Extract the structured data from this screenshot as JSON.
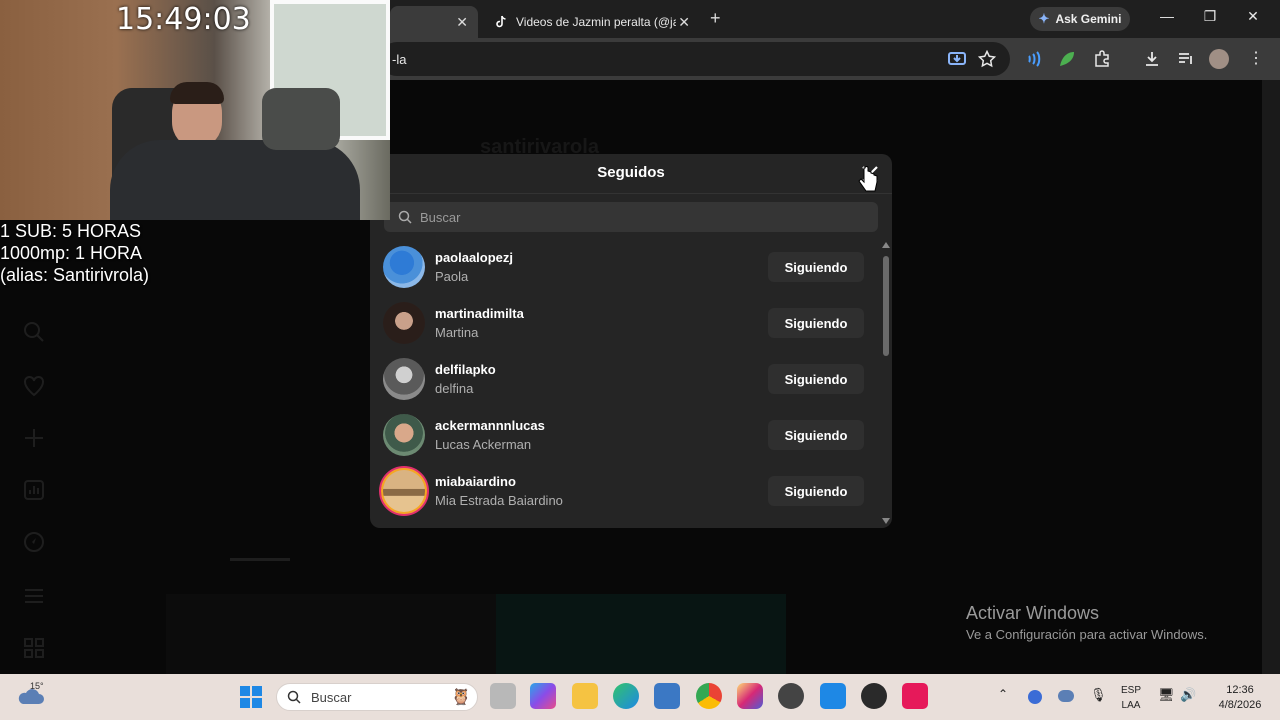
{
  "browser": {
    "tabs": [
      {
        "title": "",
        "active": true
      },
      {
        "title": "Videos de Jazmin peralta (@jaz",
        "active": false
      }
    ],
    "new_tab": "+",
    "gemini_label": "Ask Gemini",
    "address": "-la"
  },
  "page": {
    "profile_name": "santirivarola"
  },
  "modal": {
    "title": "Seguidos",
    "search_placeholder": "Buscar",
    "users": [
      {
        "username": "paolaalopezj",
        "display_name": "Paola",
        "button": "Siguiendo"
      },
      {
        "username": "martinadimilta",
        "display_name": "Martina",
        "button": "Siguiendo"
      },
      {
        "username": "delfilapko",
        "display_name": "delfina",
        "button": "Siguiendo"
      },
      {
        "username": "ackermannnlucas",
        "display_name": "Lucas Ackerman",
        "button": "Siguiendo"
      },
      {
        "username": "miabaiardino",
        "display_name": "Mia Estrada Baiardino",
        "button": "Siguiendo"
      }
    ]
  },
  "overlay": {
    "clock": "15:49:03",
    "lines": [
      "1 SUB: 5 HORAS",
      "1000mp: 1 HORA",
      "(alias: Santirivrola)"
    ]
  },
  "watermark": {
    "title": "Activar Windows",
    "subtitle": "Ve a Configuración para activar Windows."
  },
  "taskbar": {
    "weather_temp": "15°",
    "search_label": "Buscar",
    "lang_line1": "ESP",
    "lang_line2": "LAA",
    "time": "12:36",
    "date": "4/8/2026"
  },
  "colors": {
    "accent": "#e1306c",
    "modal_bg": "#252525",
    "button_bg": "#2f2f2f"
  }
}
